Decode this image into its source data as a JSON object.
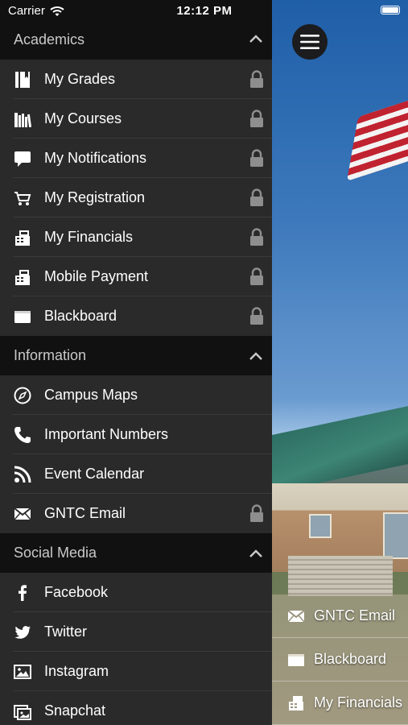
{
  "status_bar": {
    "carrier": "Carrier",
    "time": "12:12 PM",
    "battery_level": 1.0
  },
  "menu": {
    "sections": [
      {
        "title": "Academics",
        "items": [
          {
            "label": "My Grades",
            "icon": "grades-book-icon",
            "locked": true
          },
          {
            "label": "My Courses",
            "icon": "courses-books-icon",
            "locked": true
          },
          {
            "label": "My Notifications",
            "icon": "chat-bubble-icon",
            "locked": true
          },
          {
            "label": "My Registration",
            "icon": "cart-icon",
            "locked": true
          },
          {
            "label": "My Financials",
            "icon": "cash-register-icon",
            "locked": true
          },
          {
            "label": "Mobile Payment",
            "icon": "cash-register-icon",
            "locked": true
          },
          {
            "label": "Blackboard",
            "icon": "folder-icon",
            "locked": true
          }
        ]
      },
      {
        "title": "Information",
        "items": [
          {
            "label": "Campus Maps",
            "icon": "compass-icon",
            "locked": false
          },
          {
            "label": "Important Numbers",
            "icon": "phone-icon",
            "locked": false
          },
          {
            "label": "Event Calendar",
            "icon": "rss-icon",
            "locked": false
          },
          {
            "label": "GNTC Email",
            "icon": "envelope-icon",
            "locked": true
          }
        ]
      },
      {
        "title": "Social Media",
        "items": [
          {
            "label": "Facebook",
            "icon": "facebook-icon",
            "locked": false
          },
          {
            "label": "Twitter",
            "icon": "twitter-icon",
            "locked": false
          },
          {
            "label": "Instagram",
            "icon": "image-icon",
            "locked": false
          },
          {
            "label": "Snapchat",
            "icon": "snapchat-icon",
            "locked": false
          }
        ]
      }
    ]
  },
  "background_shortcuts": [
    {
      "label": "GNTC Email",
      "icon": "envelope-icon"
    },
    {
      "label": "Blackboard",
      "icon": "folder-icon"
    },
    {
      "label": "My Financials",
      "icon": "cash-register-icon"
    }
  ],
  "colors": {
    "menu_background": "#2a2a2a",
    "section_header_background": "#111111",
    "text": "#ffffff",
    "section_text": "#c9c9c9",
    "lock": "#8e8e8e"
  }
}
